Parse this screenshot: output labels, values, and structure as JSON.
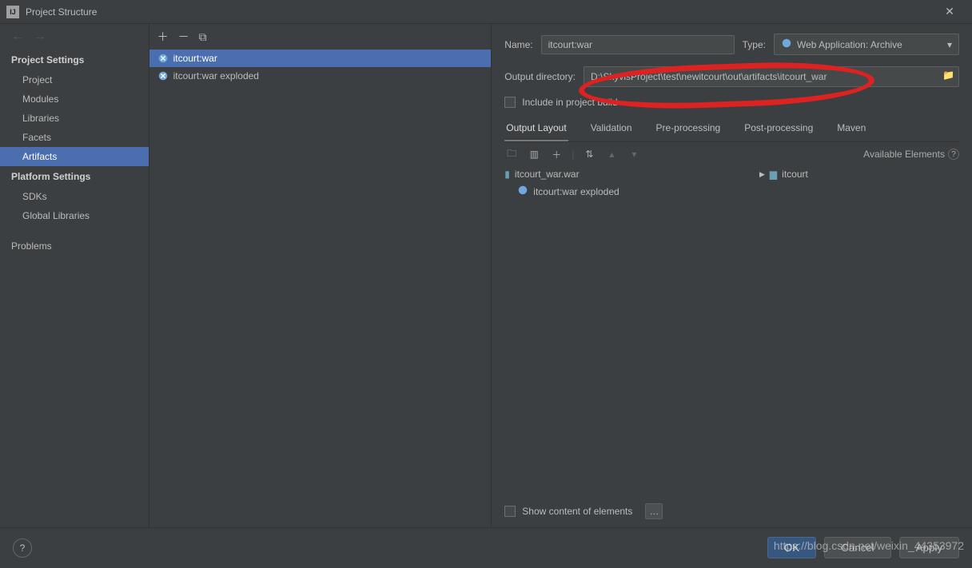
{
  "window": {
    "title": "Project Structure"
  },
  "sidebar": {
    "sections": [
      {
        "header": "Project Settings",
        "items": [
          "Project",
          "Modules",
          "Libraries",
          "Facets",
          "Artifacts"
        ]
      },
      {
        "header": "Platform Settings",
        "items": [
          "SDKs",
          "Global Libraries"
        ]
      },
      {
        "header": "",
        "items": [
          "Problems"
        ]
      }
    ],
    "selected": "Artifacts"
  },
  "artifactList": {
    "items": [
      {
        "label": "itcourt:war",
        "selected": true
      },
      {
        "label": "itcourt:war exploded",
        "selected": false
      }
    ]
  },
  "form": {
    "nameLabel": "Name:",
    "nameValue": "itcourt:war",
    "typeLabel": "Type:",
    "typeValue": "Web Application: Archive",
    "outDirLabel": "Output directory:",
    "outDirValue": "D:\\SkyvisProject\\test\\newitcourt\\out\\artifacts\\itcourt_war",
    "includeLabel": "Include in project build"
  },
  "tabs": [
    "Output Layout",
    "Validation",
    "Pre-processing",
    "Post-processing",
    "Maven"
  ],
  "activeTab": "Output Layout",
  "availableLabel": "Available Elements",
  "tree": {
    "leftRoot": "itcourt_war.war",
    "leftChild": "itcourt:war exploded",
    "rightRoot": "itcourt"
  },
  "showContentLabel": "Show content of elements",
  "buttons": {
    "ok": "OK",
    "cancel": "Cancel",
    "apply": "Apply"
  },
  "watermark": "https://blog.csdn.net/weixin_44353972"
}
